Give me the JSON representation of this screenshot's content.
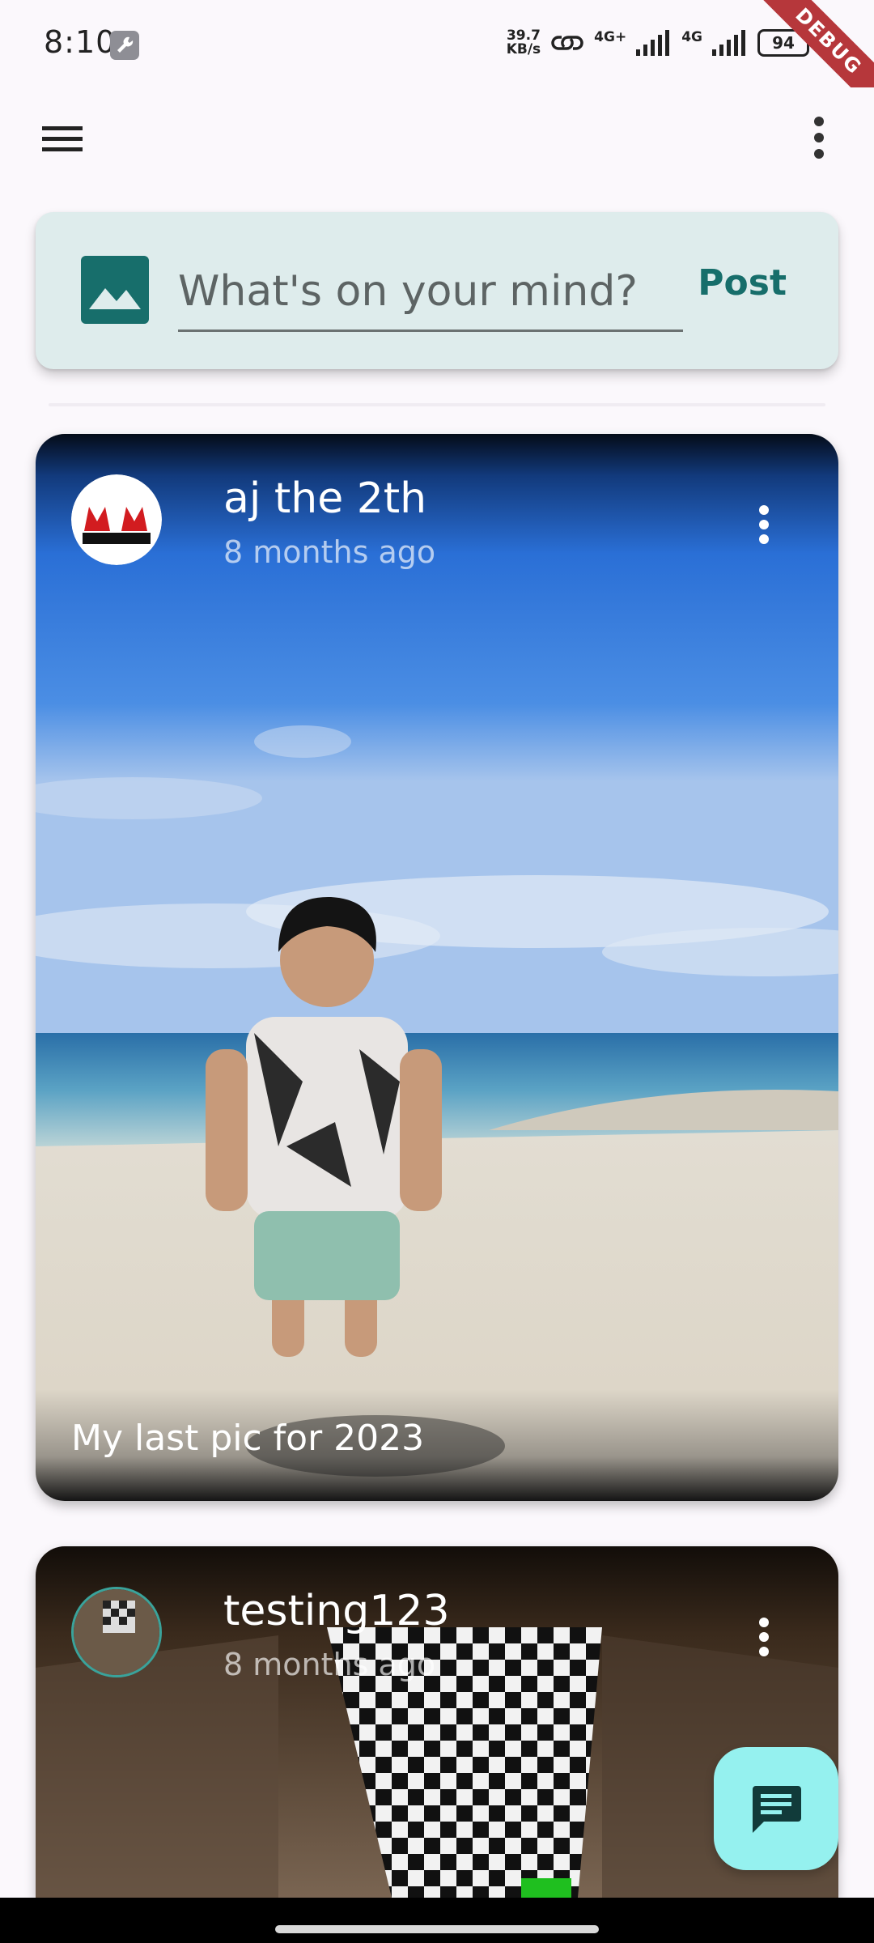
{
  "status_bar": {
    "time": "8:10",
    "net_speed_value": "39.7",
    "net_speed_unit": "KB/s",
    "sim1_label": "4G+",
    "sim2_label": "4G",
    "battery": "94",
    "debug_banner": "DEBUG"
  },
  "composer": {
    "placeholder": "What's on your mind?",
    "post_label": "Post",
    "accent": "#176e6b"
  },
  "posts": [
    {
      "author": "aj the 2th",
      "time_ago": "8 months ago",
      "caption": "My last pic for 2023"
    },
    {
      "author": "testing123",
      "time_ago": "8 months ago",
      "caption": ""
    }
  ],
  "icons": {
    "menu": "menu-icon",
    "more": "more-vert-icon",
    "image": "image-icon",
    "chat": "chat-icon"
  },
  "colors": {
    "background": "#fbf8fc",
    "composer_bg": "#deecec",
    "fab_bg": "#95f1ef",
    "debug_ribbon": "#b6373b"
  }
}
